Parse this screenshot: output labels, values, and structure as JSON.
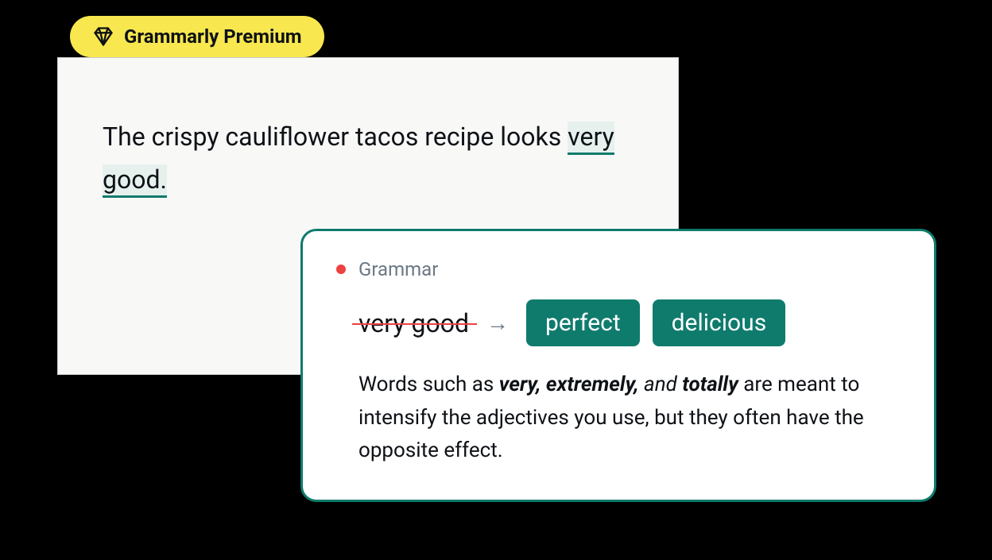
{
  "badge": {
    "label": "Grammarly Premium"
  },
  "textCard": {
    "segments": {
      "pre": "The crispy cauliflower tacos recipe looks ",
      "highlight": "very good.",
      "post": ""
    }
  },
  "suggestion": {
    "category": "Grammar",
    "original": "very good",
    "arrow": "→",
    "replacements": [
      "perfect",
      "delicious"
    ],
    "explanation": {
      "p1": "Words such as ",
      "w1": "very",
      "c1": ", ",
      "w2": "extremely,",
      "c2": " and ",
      "w3": "totally",
      "p2": " are meant to intensify the adjectives you use, but they often have the opposite effect."
    }
  }
}
